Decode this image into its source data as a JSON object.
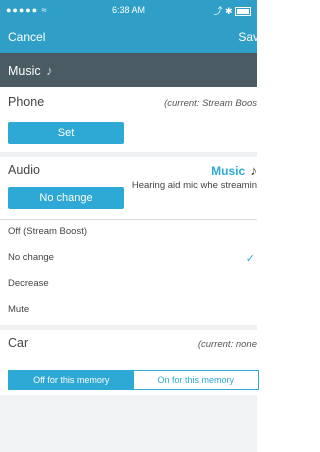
{
  "status_bar": {
    "signal": "●●●●● ≈",
    "time": "6:38 AM",
    "right": "⤴ ✱"
  },
  "nav": {
    "cancel": "Cancel",
    "save": "Sav"
  },
  "header": {
    "title": "Music",
    "icon": "music-note-icon"
  },
  "phone": {
    "label": "Phone",
    "current": "(current: Stream Boos",
    "set_button": "Set"
  },
  "audio": {
    "label": "Audio",
    "value": "Music",
    "no_change_button": "No change",
    "hearing_note": "Hearing aid mic whe streamin",
    "options": [
      {
        "label": "Off (Stream Boost)",
        "selected": false
      },
      {
        "label": "No change",
        "selected": true
      },
      {
        "label": "Decrease",
        "selected": false
      },
      {
        "label": "Mute",
        "selected": false
      }
    ],
    "check_glyph": "✓"
  },
  "car": {
    "label": "Car",
    "current": "(current: none",
    "segments": {
      "off": "Off for this memory",
      "on": "On for this memory"
    }
  },
  "colors": {
    "accent": "#2ea8d4",
    "navbar": "#2f9fc7",
    "header": "#4b5b63"
  }
}
